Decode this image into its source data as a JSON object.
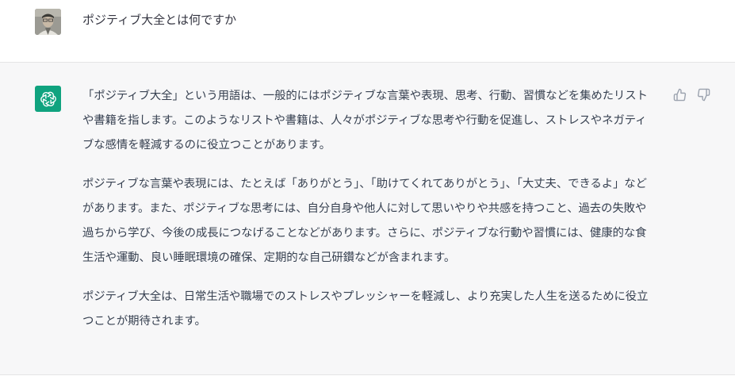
{
  "conversation": {
    "user_message": {
      "avatar": "user-photo-avatar",
      "text": "ポジティブ大全とは何ですか"
    },
    "assistant_message": {
      "avatar": "chatgpt-logo-icon",
      "accent_color": "#10a37f",
      "paragraphs": [
        "「ポジティブ大全」という用語は、一般的にはポジティブな言葉や表現、思考、行動、習慣などを集めたリストや書籍を指します。このようなリストや書籍は、人々がポジティブな思考や行動を促進し、ストレスやネガティブな感情を軽減するのに役立つことがあります。",
        "ポジティブな言葉や表現には、たとえば「ありがとう」、「助けてくれてありがとう」、「大丈夫、できるよ」などがあります。また、ポジティブな思考には、自分自身や他人に対して思いやりや共感を持つこと、過去の失敗や過ちから学び、今後の成長につなげることなどがあります。さらに、ポジティブな行動や習慣には、健康的な食生活や運動、良い睡眠環境の確保、定期的な自己研鑽などが含まれます。",
        "ポジティブ大全は、日常生活や職場でのストレスやプレッシャーを軽減し、より充実した人生を送るために役立つことが期待されます。"
      ],
      "feedback": {
        "thumbs_up_icon": "thumbs-up-icon",
        "thumbs_down_icon": "thumbs-down-icon"
      }
    }
  }
}
